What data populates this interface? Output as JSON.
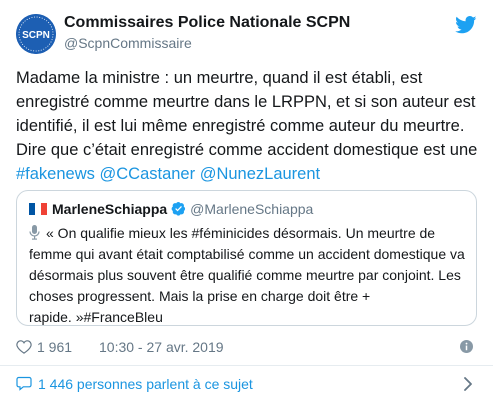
{
  "tweet": {
    "author_name": "Commissaires Police Nationale SCPN",
    "author_handle": "@ScpnCommissaire",
    "avatar_text": "SCPN",
    "text_lines": [
      "Madame la ministre : un meurtre, quand il est établi, est",
      "enregistré comme meurtre dans le LRPPN, et si son auteur est",
      "identifié, il est lui même enregistré comme auteur du meurtre.",
      "Dire que c’était enregistré comme accident domestique est une"
    ],
    "links": {
      "hashtag": "#fakenews",
      "mention1": "@CCastaner",
      "mention2": "@NunezLaurent"
    },
    "likes": "1 961",
    "timestamp": "10:30 - 27 avr. 2019"
  },
  "quoted": {
    "name": "MarleneSchiappa",
    "handle": "@MarleneSchiappa",
    "text_lines": [
      "« On qualifie mieux les #féminicides désormais. Un meurtre de",
      "femme qui avant était comptabilisé comme un accident domestique va",
      "désormais plus souvent être qualifié comme meurtre par conjoint. Les",
      "choses progressent. Mais la prise en charge doit être +",
      "rapide. »#FranceBleu"
    ]
  },
  "footer": {
    "label": "1 446 personnes parlent à ce sujet"
  },
  "colors": {
    "link": "#1b95e0",
    "secondary": "#657786",
    "border": "#ccd6dd",
    "avatar_bg": "#1d5fb3"
  },
  "icons": [
    "twitter-bird-icon",
    "verified-icon",
    "microphone-icon",
    "heart-icon",
    "info-icon",
    "speech-bubble-icon",
    "chevron-right-icon",
    "french-flag-icon"
  ]
}
